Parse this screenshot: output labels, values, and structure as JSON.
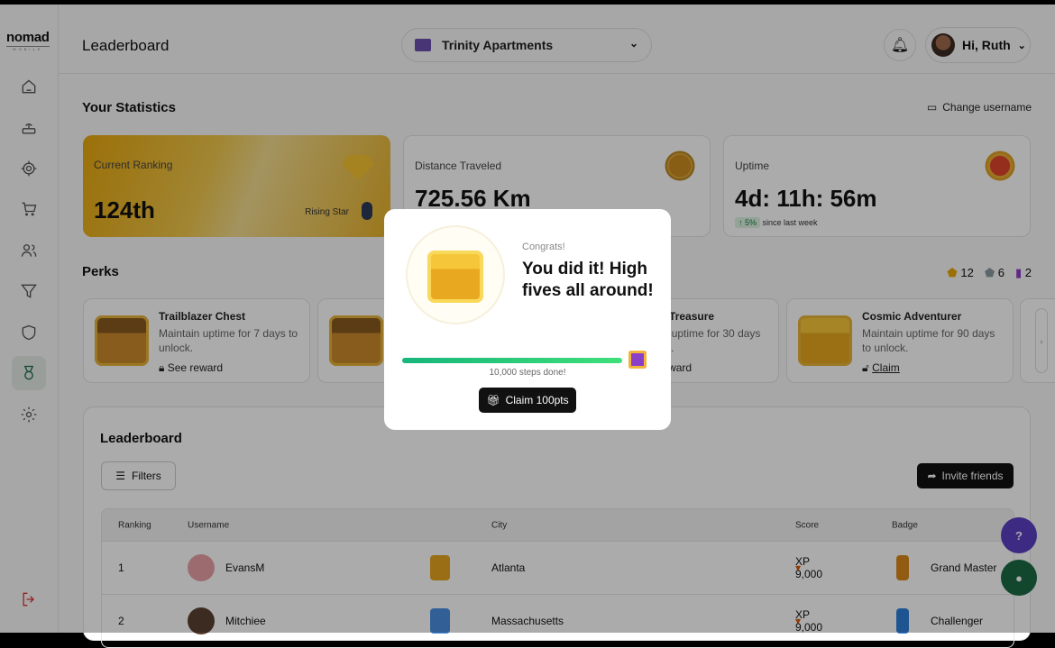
{
  "brand": {
    "logo": "nomad",
    "tagline": "MOBILE"
  },
  "sidebar": {
    "items": [
      {
        "icon": "home-icon"
      },
      {
        "icon": "router-icon"
      },
      {
        "icon": "target-icon"
      },
      {
        "icon": "cart-icon"
      },
      {
        "icon": "users-icon"
      },
      {
        "icon": "filter-icon"
      },
      {
        "icon": "shield-icon"
      },
      {
        "icon": "medal-icon",
        "active": true
      },
      {
        "icon": "gear-icon"
      }
    ],
    "logout_icon": "logout-icon"
  },
  "header": {
    "title": "Leaderboard",
    "property": "Trinity Apartments",
    "greeting": "Hi, Ruth"
  },
  "stats": {
    "title": "Your Statistics",
    "change_username": "Change username",
    "ranking": {
      "label": "Current Ranking",
      "value": "124th",
      "tier": "Rising Star"
    },
    "distance": {
      "label": "Distance Traveled",
      "value": "725.56 Km"
    },
    "uptime": {
      "label": "Uptime",
      "value": "4d: 11h: 56m",
      "change": "↑ 5%",
      "change_note": "since last week"
    }
  },
  "perks": {
    "title": "Perks",
    "counts": {
      "gold": "12",
      "silver": "6",
      "ribbon": "2"
    },
    "items": [
      {
        "title": "Trailblazer Chest",
        "desc": "Maintain uptime for 7 days to unlock.",
        "action": "See reward"
      },
      {
        "title": "",
        "desc": "",
        "action": ""
      },
      {
        "title": "Trekker Treasure",
        "desc": "Maintain uptime for 30 days to unlock.",
        "action": "See reward"
      },
      {
        "title": "Cosmic Adventurer",
        "desc": "Maintain uptime for 90 days to unlock.",
        "action": "Claim"
      }
    ]
  },
  "leaderboard": {
    "title": "Leaderboard",
    "filters": "Filters",
    "invite": "Invite friends",
    "columns": [
      "Ranking",
      "Username",
      "City",
      "Score",
      "Badge"
    ],
    "rows": [
      {
        "rank": "1",
        "user": "EvansM",
        "city": "Atlanta",
        "score": "XP 9,000",
        "badge": "Grand Master"
      },
      {
        "rank": "2",
        "user": "Mitchiee",
        "city": "Massachusetts",
        "score": "XP 9,000",
        "badge": "Challenger"
      }
    ]
  },
  "modal": {
    "subtitle": "Congrats!",
    "title": "You did it! High fives all around!",
    "progress": 1.0,
    "progress_label": "10,000 steps done!",
    "claim": "Claim 100pts"
  },
  "colors": {
    "accent": "#1b6b45",
    "progress": "#17b57a",
    "help": "#5b3fc4",
    "chat": "#1b6b45"
  }
}
